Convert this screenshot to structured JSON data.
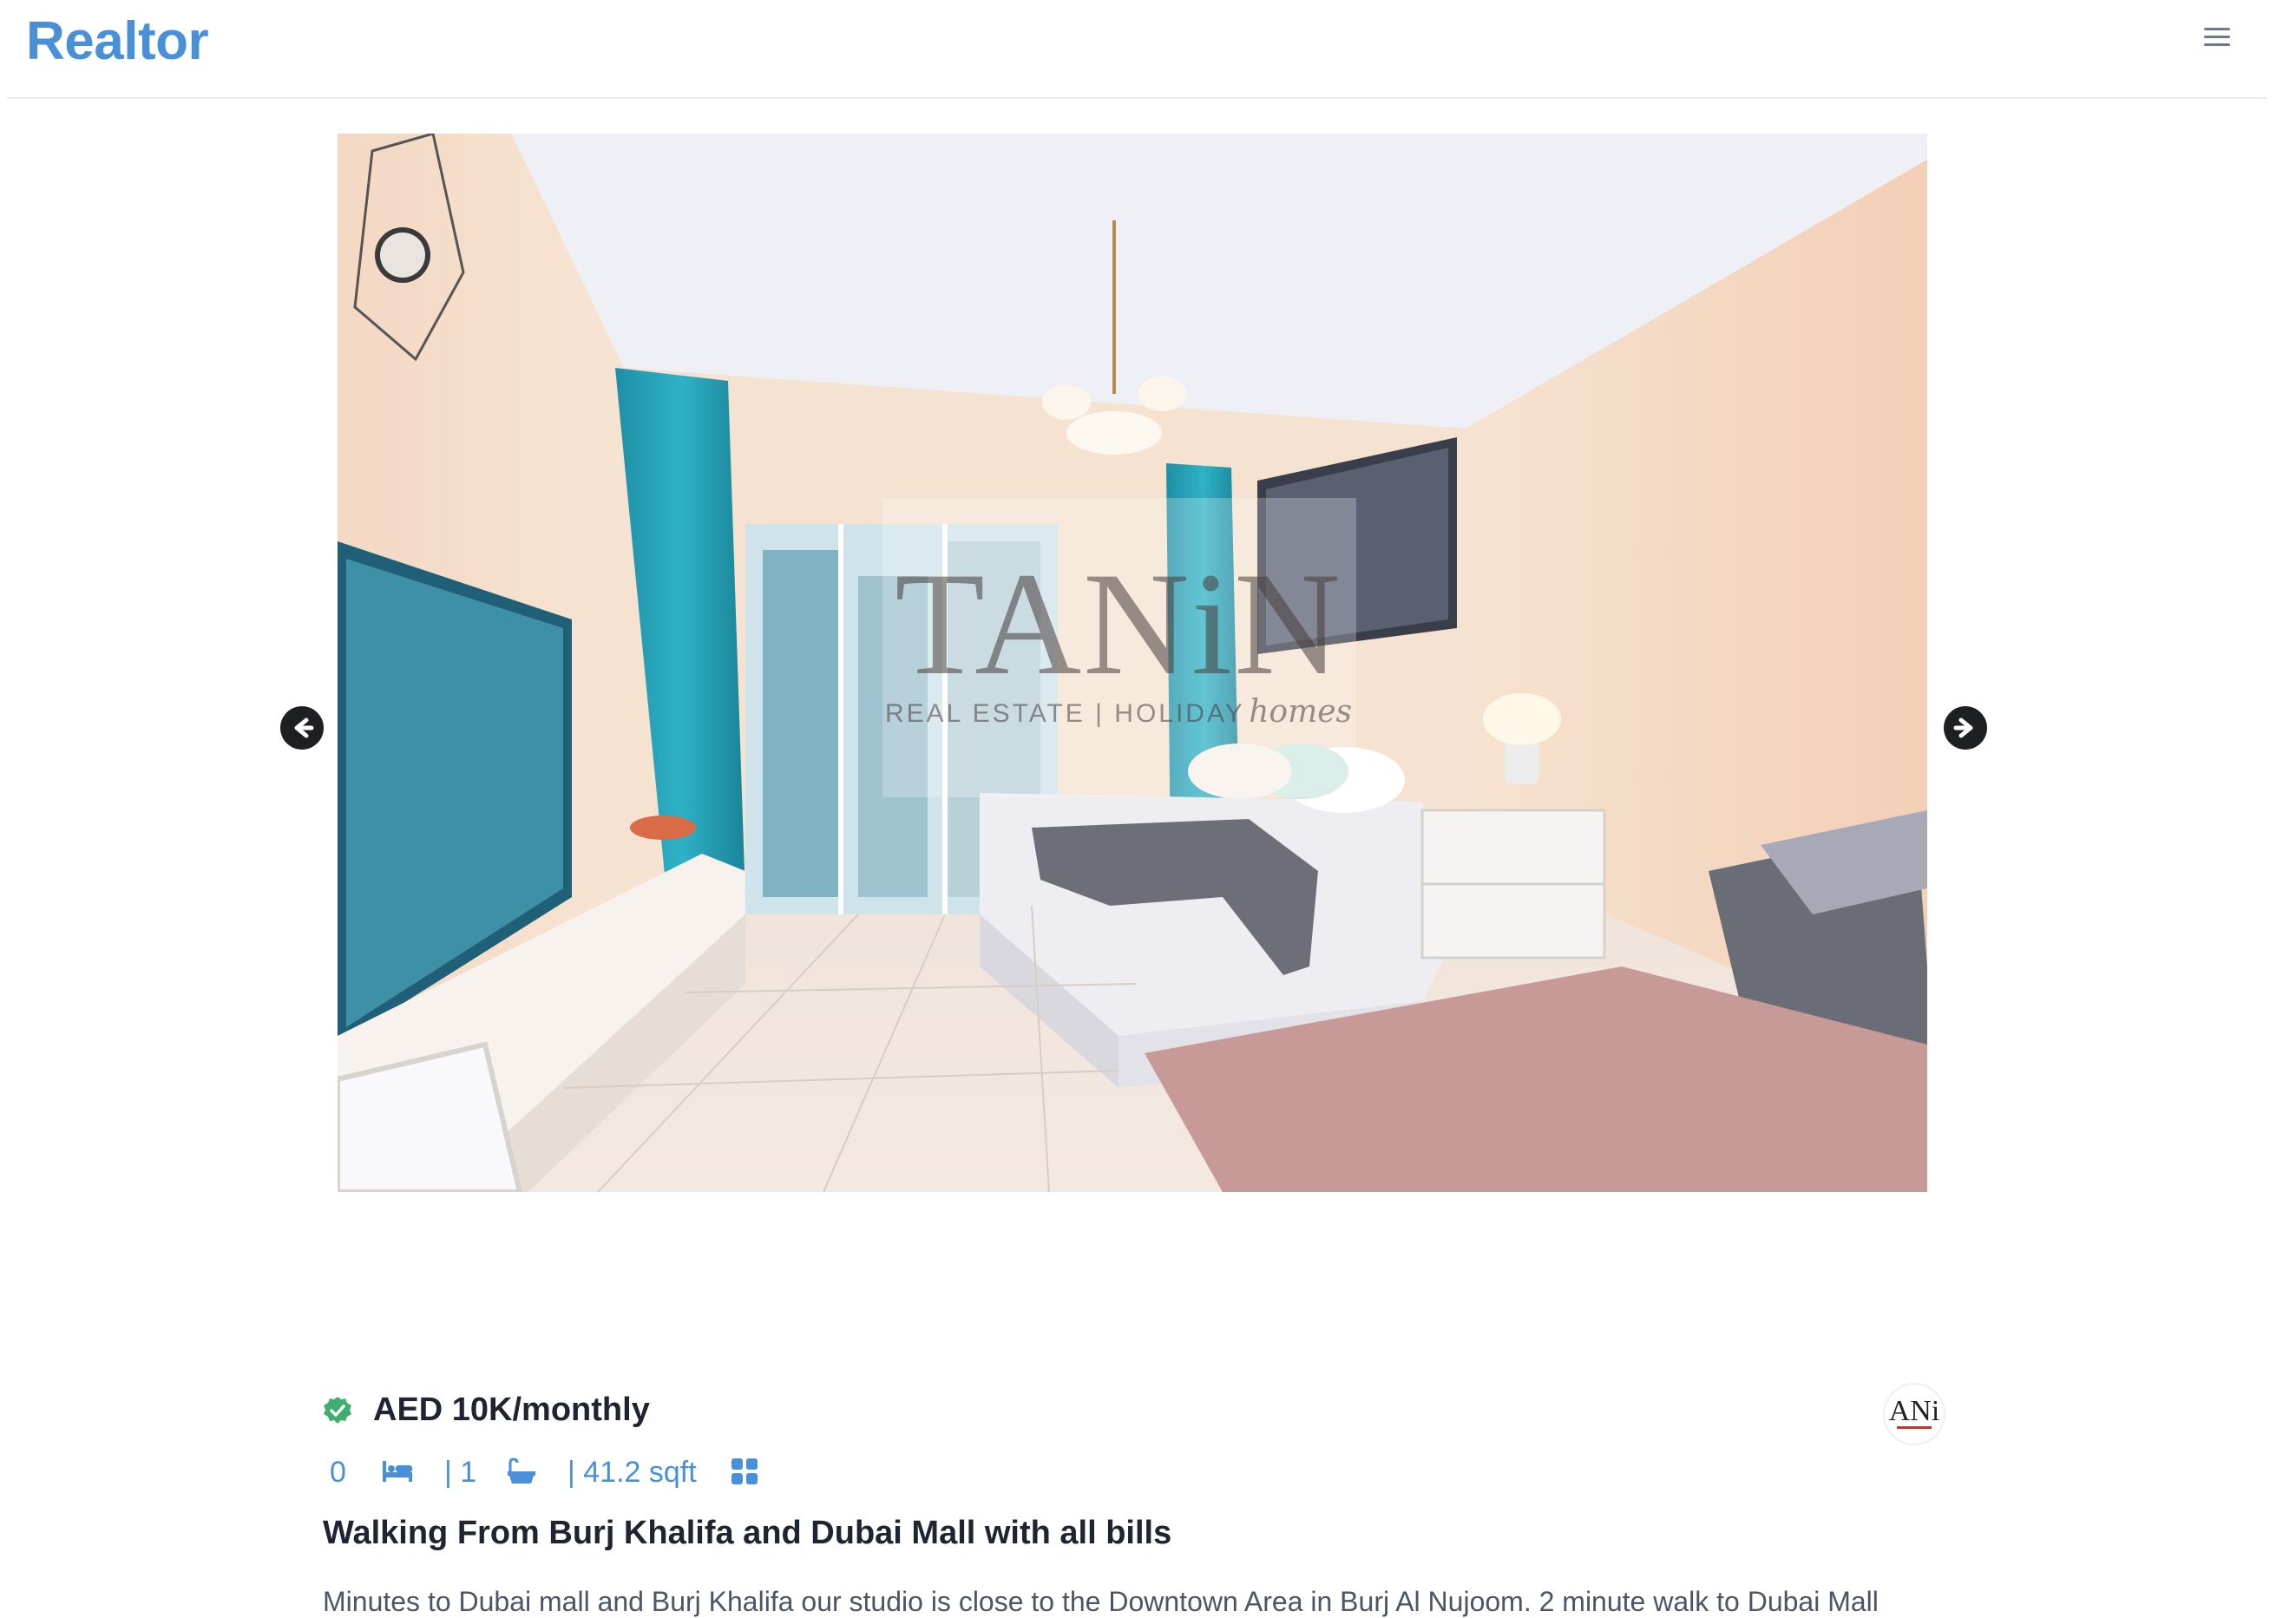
{
  "header": {
    "brand": "Realtor",
    "menu_icon": "hamburger-menu-icon"
  },
  "gallery": {
    "photo_description_icon": "property-photo",
    "watermark": {
      "logo_text": "TANiN",
      "line1": "REAL ESTATE | HOLIDAY",
      "line2": "homes"
    },
    "prev_icon": "arrow-left-circle-icon",
    "next_icon": "arrow-right-circle-icon"
  },
  "listing": {
    "verified_icon": "verified-check-icon",
    "price": "AED 10K/monthly",
    "bedrooms": "0",
    "bathrooms": "| 1",
    "area": "| 41.2 sqft",
    "agency_logo_text": "ANi",
    "title": "Walking From Burj Khalifa and Dubai Mall with all bills",
    "description": "Minutes to Dubai mall and Burj Khalifa our studio is close to the Downtown Area in Burj Al Nujoom. 2 minute walk to Dubai Mall"
  },
  "colors": {
    "brand": "#4a90d9",
    "verified": "#3fae6e",
    "text": "#1f2530"
  }
}
